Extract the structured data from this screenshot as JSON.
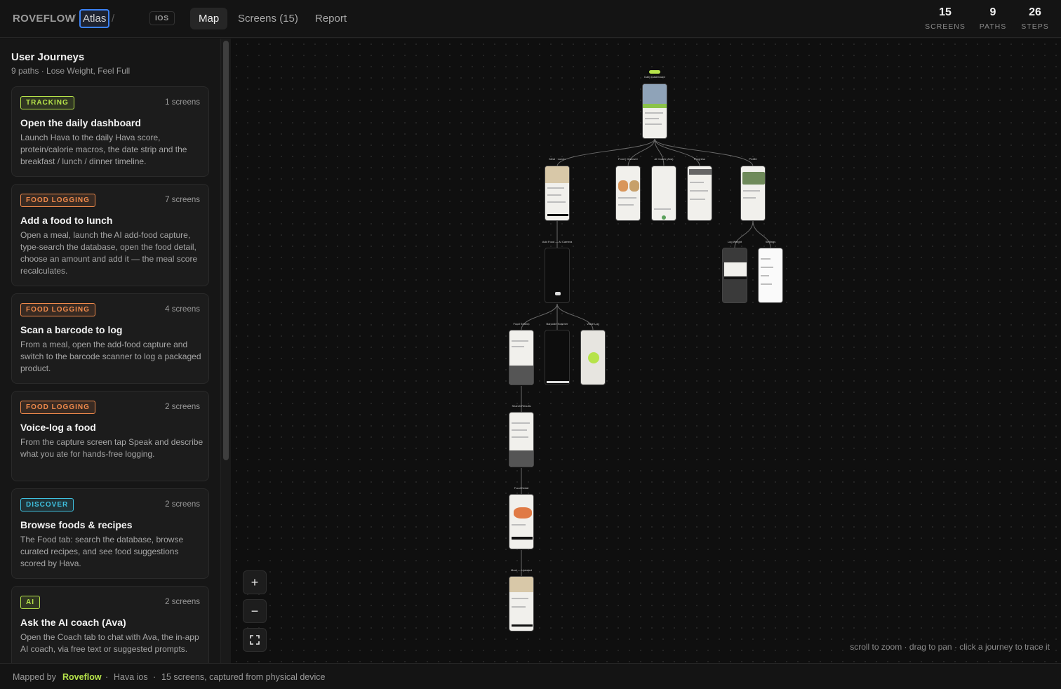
{
  "header": {
    "brand": "ROVEFLOW",
    "sep": "/",
    "project": "Atlas",
    "platform": "IOS",
    "tabs": [
      {
        "label": "Map",
        "active": true
      },
      {
        "label": "Screens (15)",
        "active": false
      },
      {
        "label": "Report",
        "active": false
      }
    ],
    "stats": [
      {
        "value": "15",
        "label": "SCREENS"
      },
      {
        "value": "9",
        "label": "PATHS"
      },
      {
        "value": "26",
        "label": "STEPS"
      }
    ]
  },
  "sidebar": {
    "title": "User Journeys",
    "subtitle": "9 paths · Lose Weight, Feel Full",
    "journeys": [
      {
        "tag": "TRACKING",
        "tag_color": "#b6e34a",
        "count": "1 screens",
        "title": "Open the daily dashboard",
        "desc": "Launch Hava to the daily Hava score, protein/calorie macros, the date strip and the breakfast / lunch / dinner timeline."
      },
      {
        "tag": "FOOD LOGGING",
        "tag_color": "#f08a4b",
        "count": "7 screens",
        "title": "Add a food to lunch",
        "desc": "Open a meal, launch the AI add-food capture, type-search the database, open the food detail, choose an amount and add it — the meal score recalculates."
      },
      {
        "tag": "FOOD LOGGING",
        "tag_color": "#f08a4b",
        "count": "4 screens",
        "title": "Scan a barcode to log",
        "desc": "From a meal, open the add-food capture and switch to the barcode scanner to log a packaged product."
      },
      {
        "tag": "FOOD LOGGING",
        "tag_color": "#f08a4b",
        "count": "2 screens",
        "title": "Voice-log a food",
        "desc": "From the capture screen tap Speak and describe what you ate for hands-free logging."
      },
      {
        "tag": "DISCOVER",
        "tag_color": "#3fc1e0",
        "count": "2 screens",
        "title": "Browse foods & recipes",
        "desc": "The Food tab: search the database, browse curated recipes, and see food suggestions scored by Hava."
      },
      {
        "tag": "AI",
        "tag_color": "#b6e34a",
        "count": "2 screens",
        "title": "Ask the AI coach (Ava)",
        "desc": "Open the Coach tab to chat with Ava, the in-app AI coach, via free text or suggested prompts."
      }
    ]
  },
  "canvas": {
    "start_label": "START",
    "nodes": [
      {
        "label": "Daily Dashboard",
        "dark": false
      },
      {
        "label": "Meal · Lunch",
        "dark": false
      },
      {
        "label": "Food | Discover",
        "dark": false
      },
      {
        "label": "AI Coach (Ava)",
        "dark": false
      },
      {
        "label": "Progress",
        "dark": false
      },
      {
        "label": "Profile",
        "dark": false
      },
      {
        "label": "Add Food — AI Camera",
        "dark": true
      },
      {
        "label": "Log Weight",
        "dark": true
      },
      {
        "label": "Settings",
        "dark": false
      },
      {
        "label": "Food Search",
        "dark": false
      },
      {
        "label": "Barcode Scanner",
        "dark": true
      },
      {
        "label": "Voice Log",
        "dark": false
      },
      {
        "label": "Search Results",
        "dark": false
      },
      {
        "label": "Food Detail",
        "dark": false
      },
      {
        "label": "Meal — Updated",
        "dark": false
      }
    ],
    "zoom_in": "+",
    "zoom_out": "−",
    "fit_icon": "fullscreen-icon",
    "hint": "scroll to zoom · drag to pan · click a journey to trace it"
  },
  "footer": {
    "mapped_by": "Mapped by",
    "brand": "Roveflow",
    "dot": "·",
    "app": "Hava ios",
    "info": "15 screens, captured from physical device"
  }
}
